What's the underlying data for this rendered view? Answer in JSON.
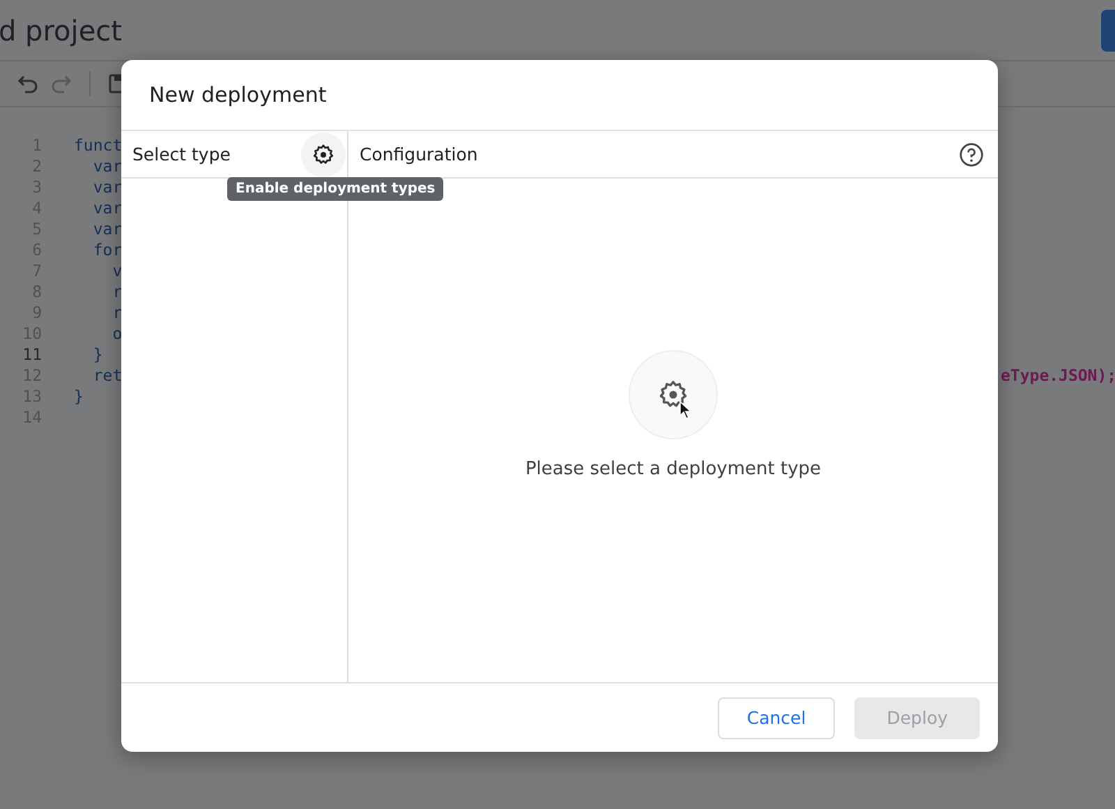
{
  "editor": {
    "title": "d project",
    "lines": [
      {
        "number": "1",
        "code": "funct",
        "current": false
      },
      {
        "number": "2",
        "code": "  var",
        "current": false
      },
      {
        "number": "3",
        "code": "  var",
        "current": false
      },
      {
        "number": "4",
        "code": "  var",
        "current": false
      },
      {
        "number": "5",
        "code": "  var",
        "current": false
      },
      {
        "number": "6",
        "code": "  for",
        "current": false
      },
      {
        "number": "7",
        "code": "    v",
        "current": false
      },
      {
        "number": "8",
        "code": "    r",
        "current": false
      },
      {
        "number": "9",
        "code": "    r",
        "current": false
      },
      {
        "number": "10",
        "code": "    o",
        "current": false
      },
      {
        "number": "11",
        "code": "  }",
        "current": true
      },
      {
        "number": "12",
        "code": "  ret",
        "tail": "eType.JSON);",
        "current": false
      },
      {
        "number": "13",
        "code": "}",
        "current": false
      },
      {
        "number": "14",
        "current": false
      }
    ]
  },
  "dialog": {
    "title": "New deployment",
    "left_header": "Select type",
    "tooltip": "Enable deployment types",
    "right_header": "Configuration",
    "empty_message": "Please select a deployment type",
    "buttons": [
      {
        "label": "Cancel",
        "kind": "secondary",
        "disabled": false
      },
      {
        "label": "Deploy",
        "kind": "primary",
        "disabled": true
      }
    ]
  }
}
